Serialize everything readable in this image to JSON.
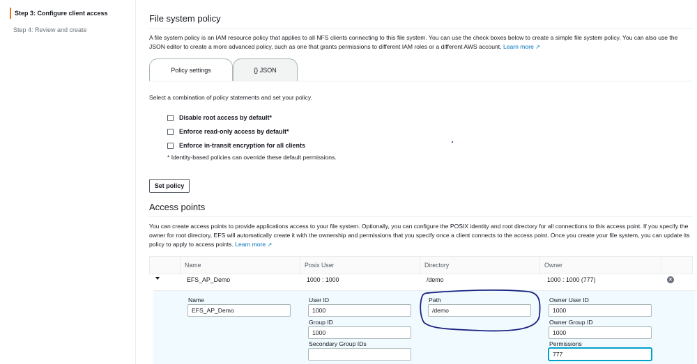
{
  "sidebar": {
    "steps": [
      {
        "label": "Step 3: Configure client access",
        "active": true
      },
      {
        "label": "Step 4: Review and create",
        "active": false
      }
    ]
  },
  "fs_policy": {
    "title": "File system policy",
    "description": "A file system policy is an IAM resource policy that applies to all NFS clients connecting to this file system. You can use the check boxes below to create a simple file system policy. You can also use the JSON editor to create a more advanced policy, such as one that grants permissions to different IAM roles or a different AWS account.",
    "learn_more": "Learn more",
    "tabs": [
      {
        "label": "Policy settings"
      },
      {
        "label": "{} JSON"
      }
    ],
    "instruction": "Select a combination of policy statements and set your policy.",
    "checkboxes": [
      {
        "label": "Disable root access by default*",
        "checked": false
      },
      {
        "label": "Enforce read-only access by default*",
        "checked": false
      },
      {
        "label": "Enforce in-transit encryption for all clients",
        "checked": false
      }
    ],
    "footnote": "* Identity-based policies can override these default permissions.",
    "set_policy_label": "Set policy"
  },
  "access_points": {
    "title": "Access points",
    "description": "You can create access points to provide applications access to your file system. Optionally, you can configure the POSIX identity and root directory for all connections to this access point. If you specify the owner for root directory, EFS will automatically create it with the ownership and permissions that you specify once a client connects to the access point. Once you create your file system, you can update its policy to apply to access points.",
    "learn_more": "Learn more",
    "columns": [
      "Name",
      "Posix User",
      "Directory",
      "Owner"
    ],
    "rows": [
      {
        "name": "EFS_AP_Demo",
        "posix_user": "1000 : 1000",
        "directory": "/demo",
        "owner": "1000 : 1000 (777)"
      }
    ],
    "form": {
      "name_label": "Name",
      "name_value": "EFS_AP_Demo",
      "user_id_label": "User ID",
      "user_id_value": "1000",
      "group_id_label": "Group ID",
      "group_id_value": "1000",
      "secondary_label": "Secondary Group IDs",
      "secondary_value": "",
      "path_label": "Path",
      "path_value": "/demo",
      "owner_user_label": "Owner User ID",
      "owner_user_value": "1000",
      "owner_group_label": "Owner Group ID",
      "owner_group_value": "1000",
      "permissions_label": "Permissions",
      "permissions_value": "777"
    }
  },
  "colors": {
    "accent": "#ec7211",
    "link": "#0073bb",
    "annotation": "#1a237e"
  }
}
